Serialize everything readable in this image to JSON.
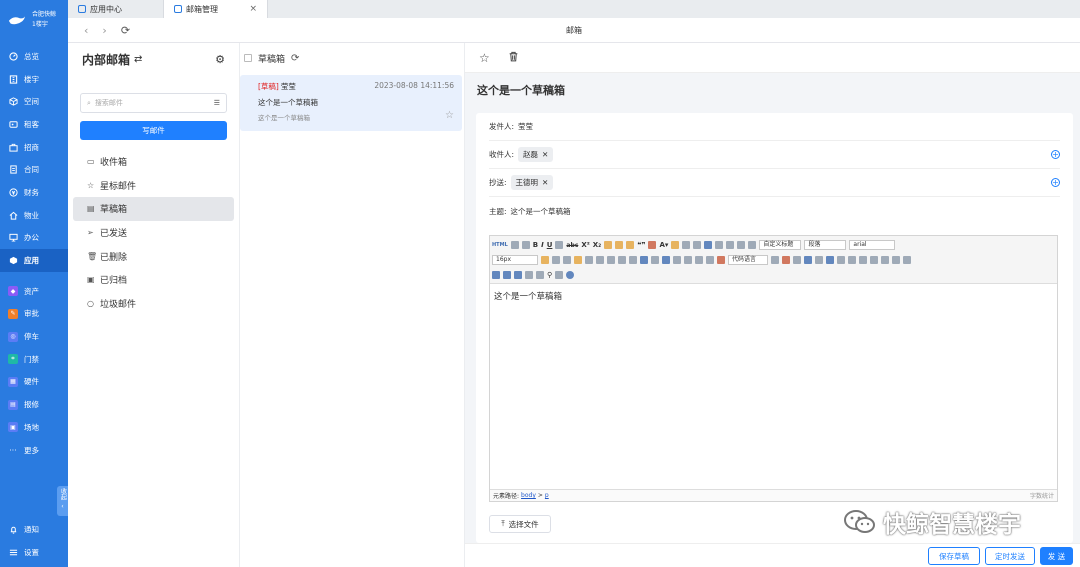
{
  "sidebar": {
    "brand": {
      "line1": "合肥快鲸",
      "line2": "1楼宇"
    },
    "items": [
      {
        "label": "总览",
        "icon": "gauge-icon"
      },
      {
        "label": "楼宇",
        "icon": "building-icon"
      },
      {
        "label": "空间",
        "icon": "cube-icon"
      },
      {
        "label": "租客",
        "icon": "tenant-icon"
      },
      {
        "label": "招商",
        "icon": "invest-icon"
      },
      {
        "label": "合同",
        "icon": "contract-icon"
      },
      {
        "label": "财务",
        "icon": "finance-icon"
      },
      {
        "label": "物业",
        "icon": "property-icon"
      },
      {
        "label": "办公",
        "icon": "monitor-icon"
      },
      {
        "label": "应用",
        "icon": "apps-icon"
      }
    ],
    "apps": [
      {
        "label": "资产",
        "color": "#8a5cf6"
      },
      {
        "label": "审批",
        "color": "#f07f2a"
      },
      {
        "label": "停车",
        "color": "#5b7cf5"
      },
      {
        "label": "门禁",
        "color": "#1fb8a6"
      },
      {
        "label": "硬件",
        "color": "#5b7cf5"
      },
      {
        "label": "报修",
        "color": "#5b7cf5"
      },
      {
        "label": "场地",
        "color": "#5b7cf5"
      }
    ],
    "more": "更多",
    "collapse": "收起",
    "notify": "通知",
    "settings": "设置"
  },
  "tabs": [
    {
      "label": "应用中心"
    },
    {
      "label": "邮箱管理"
    }
  ],
  "page_title": "邮箱",
  "folders": {
    "title": "内部邮箱",
    "search_placeholder": "搜索邮件",
    "write_label": "写邮件",
    "items": [
      "收件箱",
      "星标邮件",
      "草稿箱",
      "已发送",
      "已删除",
      "已归档",
      "垃圾邮件"
    ]
  },
  "mail_list": {
    "title": "草稿箱",
    "item": {
      "tag": "[草稿]",
      "sender": "莹莹",
      "date": "2023-08-08 14:11:56",
      "subject": "这个是一个草稿箱",
      "preview": "这个是一个草稿箱"
    }
  },
  "detail": {
    "title": "这个是一个草稿箱",
    "from_label": "发件人:",
    "from": "莹莹",
    "to_label": "收件人:",
    "to": "赵磊",
    "cc_label": "抄送:",
    "cc": "王德明",
    "subject_label": "主题:",
    "subject": "这个是一个草稿箱",
    "editor": {
      "font_size": "16px",
      "heading": "自定义标题",
      "paragraph": "段落",
      "font": "arial",
      "code_lang": "代码语言",
      "body": "这个是一个草稿箱",
      "path_label": "元素路径:",
      "path_body": "body",
      "path_p": "p",
      "word_count": "字数统计"
    },
    "file_label": "选择文件"
  },
  "footer": {
    "save": "保存草稿",
    "schedule": "定时发送",
    "send": "发 送"
  },
  "watermark": "快鲸智慧楼宇"
}
